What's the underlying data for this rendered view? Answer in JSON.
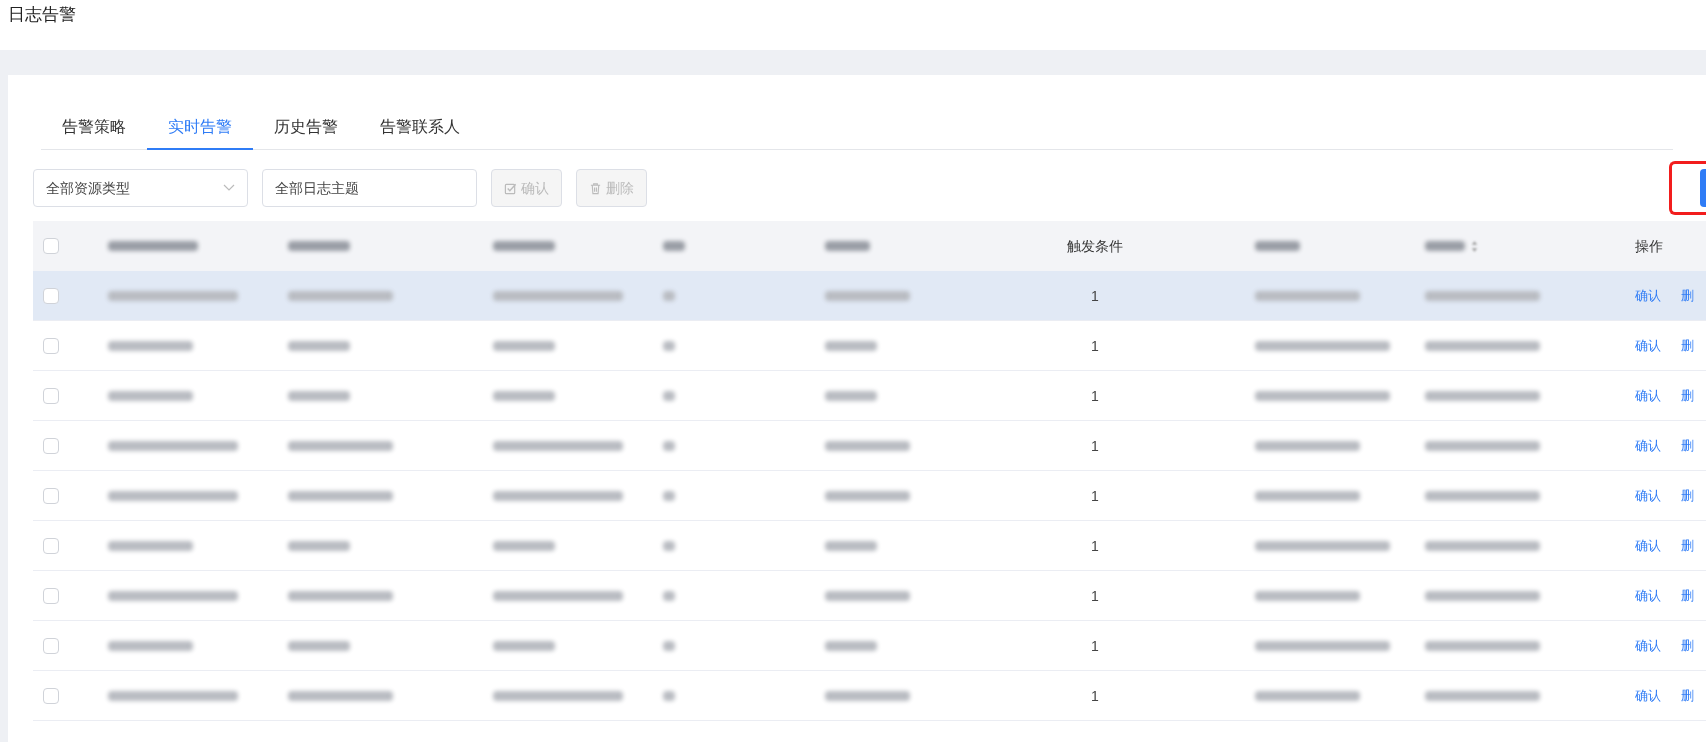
{
  "page_title": "日志告警",
  "tabs": [
    {
      "label": "告警策略",
      "selected": false
    },
    {
      "label": "实时告警",
      "selected": true
    },
    {
      "label": "历史告警",
      "selected": false
    },
    {
      "label": "告警联系人",
      "selected": false
    }
  ],
  "filters": {
    "resource_type": {
      "value": "全部资源类型"
    },
    "log_topic": {
      "value": "全部日志主题"
    }
  },
  "buttons": [
    {
      "kind": "confirm",
      "label": "确认",
      "disabled": true
    },
    {
      "kind": "delete",
      "label": "删除",
      "disabled": true
    }
  ],
  "table": {
    "select_all": {
      "checked": false
    },
    "columns": {
      "trigger": "触发条件",
      "actions": "操作"
    },
    "rows": [
      {
        "kind": "long",
        "checked": false,
        "highlighted": true,
        "trigger": "1",
        "actions": [
          "确认",
          "删"
        ]
      },
      {
        "kind": "short",
        "checked": false,
        "highlighted": false,
        "trigger": "1",
        "actions": [
          "确认",
          "删"
        ]
      },
      {
        "kind": "short",
        "checked": false,
        "highlighted": false,
        "trigger": "1",
        "actions": [
          "确认",
          "删"
        ]
      },
      {
        "kind": "long",
        "checked": false,
        "highlighted": false,
        "trigger": "1",
        "actions": [
          "确认",
          "删"
        ]
      },
      {
        "kind": "long",
        "checked": false,
        "highlighted": false,
        "trigger": "1",
        "actions": [
          "确认",
          "删"
        ]
      },
      {
        "kind": "short",
        "checked": false,
        "highlighted": false,
        "trigger": "1",
        "actions": [
          "确认",
          "删"
        ]
      },
      {
        "kind": "long",
        "checked": false,
        "highlighted": false,
        "trigger": "1",
        "actions": [
          "确认",
          "删"
        ]
      },
      {
        "kind": "short",
        "checked": false,
        "highlighted": false,
        "trigger": "1",
        "actions": [
          "确认",
          "删"
        ]
      },
      {
        "kind": "long",
        "checked": false,
        "highlighted": false,
        "trigger": "1",
        "actions": [
          "确认",
          "删"
        ]
      }
    ]
  }
}
